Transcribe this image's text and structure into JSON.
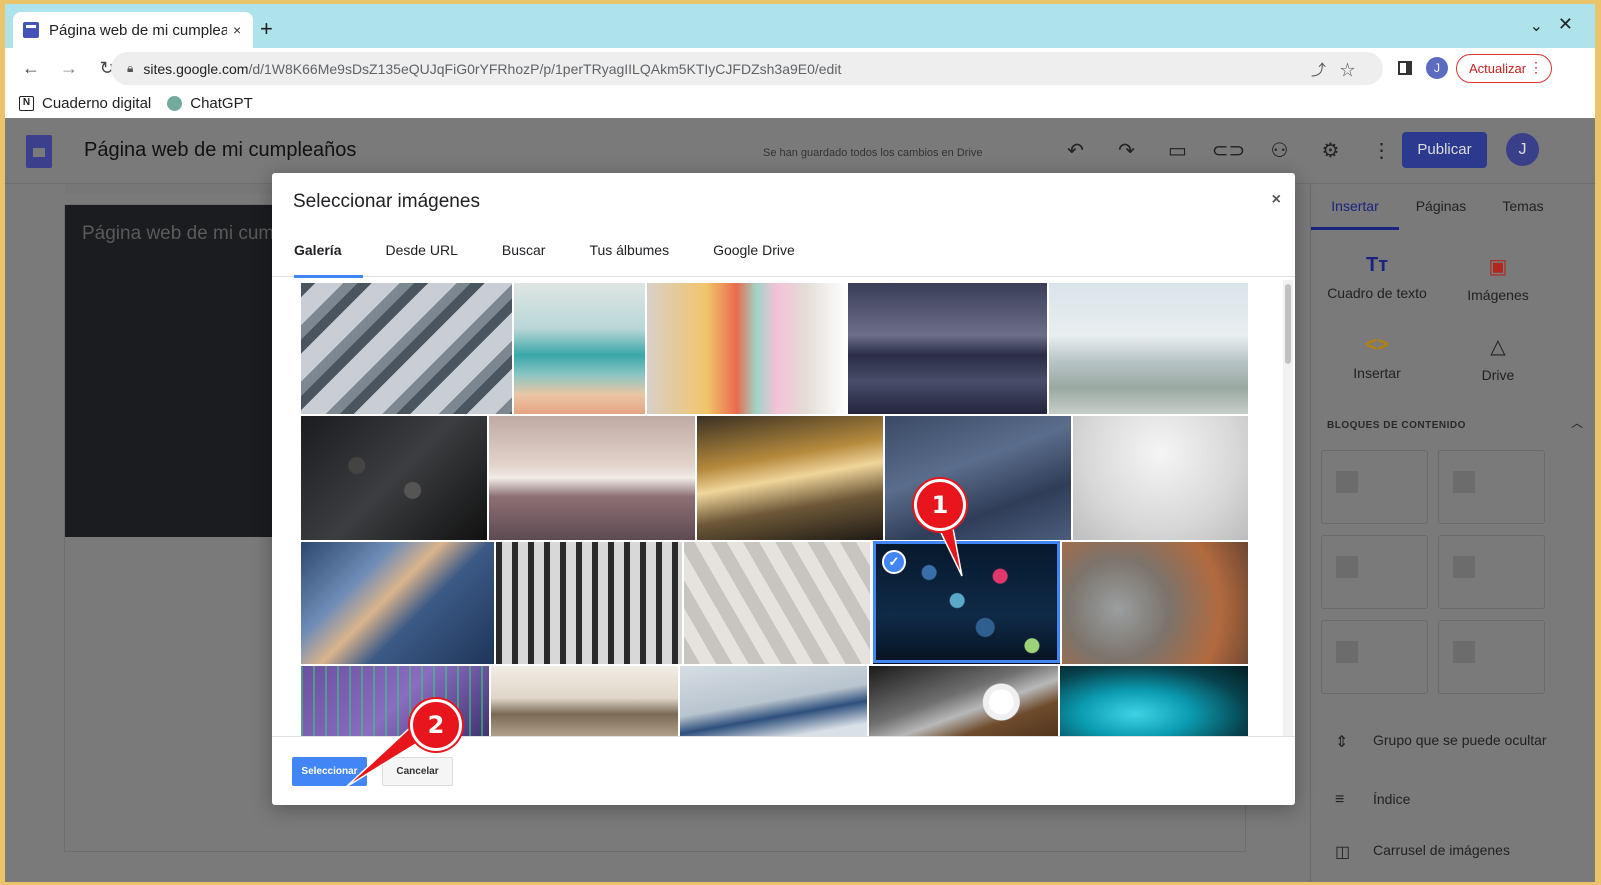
{
  "browser": {
    "tab_title": "Página web de mi cumpleaños",
    "new_tab": "+",
    "tab_close": "×",
    "url_domain": "sites.google.com",
    "url_path": "/d/1W8K66Me9sDsZ135eQUJqFiG0rYFRhozP/p/1perTRyagIILQAkm5KTIyCJFDZsh3a9E0/edit",
    "profile_initial": "J",
    "update_label": "Actualizar",
    "bookmarks": [
      {
        "label": "Cuaderno digital",
        "icon": "notion-icon"
      },
      {
        "label": "ChatGPT",
        "icon": "chatgpt-icon"
      }
    ]
  },
  "app": {
    "site_title": "Página web de mi cumpleaños",
    "save_status": "Se han guardado todos los cambios en Drive",
    "publish_label": "Publicar",
    "user_initial": "J",
    "hero_text": "Página web de mi cumpleaños"
  },
  "panel": {
    "tabs": [
      "Insertar",
      "Páginas",
      "Temas"
    ],
    "tools": [
      {
        "label": "Cuadro de texto",
        "icon": "Tт"
      },
      {
        "label": "Imágenes",
        "icon": "▣"
      },
      {
        "label": "Insertar",
        "icon": "<>"
      },
      {
        "label": "Drive",
        "icon": "△"
      }
    ],
    "section": "BLOQUES DE CONTENIDO",
    "list": [
      {
        "label": "Grupo que se puede ocultar",
        "icon": "⇕"
      },
      {
        "label": "Índice",
        "icon": "≡"
      },
      {
        "label": "Carrusel de imágenes",
        "icon": "◫"
      }
    ]
  },
  "dialog": {
    "title": "Seleccionar imágenes",
    "close": "×",
    "tabs": [
      "Galería",
      "Desde URL",
      "Buscar",
      "Tus álbumes",
      "Google Drive"
    ],
    "active_tab": "Galería",
    "check": "✓",
    "select_label": "Seleccionar",
    "cancel_label": "Cancelar"
  },
  "annotations": [
    {
      "label": "1",
      "color": "#e8161c"
    },
    {
      "label": "2",
      "color": "#e8161c"
    }
  ],
  "colors": {
    "accent": "#4285f4",
    "publish": "#2b3a8e",
    "annotation": "#e8161c"
  }
}
